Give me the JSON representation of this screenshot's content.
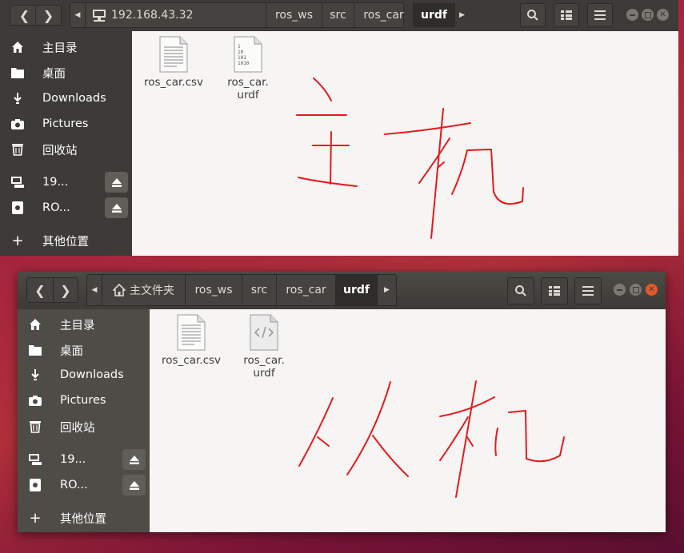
{
  "windows": [
    {
      "location": "192.168.43.32",
      "breadcrumbs": [
        "ros_ws",
        "src",
        "ros_car",
        "urdf"
      ],
      "sidebar": [
        "主目录",
        "桌面",
        "Downloads",
        "Pictures",
        "回收站",
        "19...",
        "RO...",
        "其他位置"
      ],
      "files": [
        {
          "name": "ros_car.csv",
          "icon": "text-file-icon"
        },
        {
          "name": "ros_car.\nurdf",
          "icon": "binary-file-icon"
        }
      ],
      "annotation": "主机"
    },
    {
      "location": "主文件夹",
      "breadcrumbs": [
        "ros_ws",
        "src",
        "ros_car",
        "urdf"
      ],
      "sidebar": [
        "主目录",
        "桌面",
        "Downloads",
        "Pictures",
        "回收站",
        "19...",
        "RO...",
        "其他位置"
      ],
      "files": [
        {
          "name": "ros_car.csv",
          "icon": "text-file-icon"
        },
        {
          "name": "ros_car.\nurdf",
          "icon": "code-file-icon"
        }
      ],
      "annotation": "从机"
    }
  ],
  "colors": {
    "header": "#3c3b37",
    "sidebar": "#3c3b37",
    "content": "#f6f5f4",
    "ink": "#e8191b",
    "close": "#e05a2b"
  }
}
